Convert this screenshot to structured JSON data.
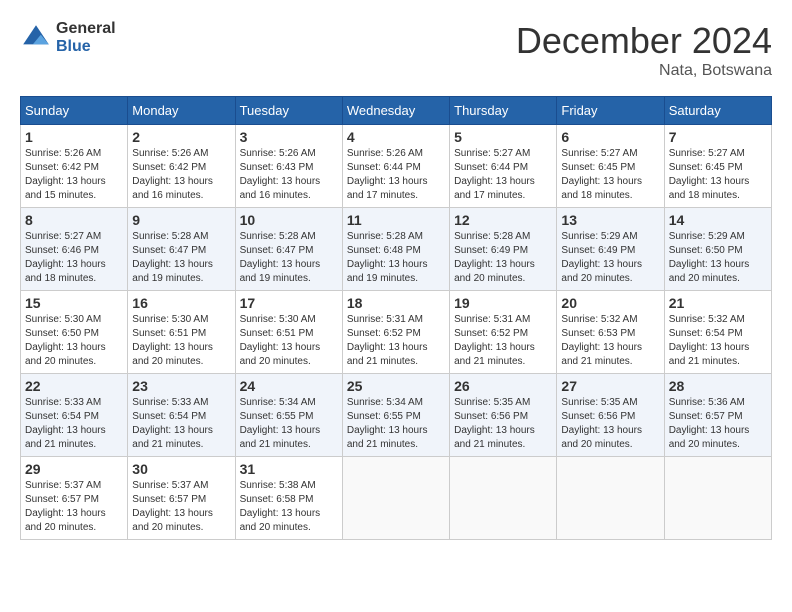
{
  "header": {
    "logo_general": "General",
    "logo_blue": "Blue",
    "month_title": "December 2024",
    "location": "Nata, Botswana"
  },
  "weekdays": [
    "Sunday",
    "Monday",
    "Tuesday",
    "Wednesday",
    "Thursday",
    "Friday",
    "Saturday"
  ],
  "weeks": [
    [
      {
        "day": 1,
        "sunrise": "5:26 AM",
        "sunset": "6:42 PM",
        "daylight": "13 hours and 15 minutes."
      },
      {
        "day": 2,
        "sunrise": "5:26 AM",
        "sunset": "6:42 PM",
        "daylight": "13 hours and 16 minutes."
      },
      {
        "day": 3,
        "sunrise": "5:26 AM",
        "sunset": "6:43 PM",
        "daylight": "13 hours and 16 minutes."
      },
      {
        "day": 4,
        "sunrise": "5:26 AM",
        "sunset": "6:44 PM",
        "daylight": "13 hours and 17 minutes."
      },
      {
        "day": 5,
        "sunrise": "5:27 AM",
        "sunset": "6:44 PM",
        "daylight": "13 hours and 17 minutes."
      },
      {
        "day": 6,
        "sunrise": "5:27 AM",
        "sunset": "6:45 PM",
        "daylight": "13 hours and 18 minutes."
      },
      {
        "day": 7,
        "sunrise": "5:27 AM",
        "sunset": "6:45 PM",
        "daylight": "13 hours and 18 minutes."
      }
    ],
    [
      {
        "day": 8,
        "sunrise": "5:27 AM",
        "sunset": "6:46 PM",
        "daylight": "13 hours and 18 minutes."
      },
      {
        "day": 9,
        "sunrise": "5:28 AM",
        "sunset": "6:47 PM",
        "daylight": "13 hours and 19 minutes."
      },
      {
        "day": 10,
        "sunrise": "5:28 AM",
        "sunset": "6:47 PM",
        "daylight": "13 hours and 19 minutes."
      },
      {
        "day": 11,
        "sunrise": "5:28 AM",
        "sunset": "6:48 PM",
        "daylight": "13 hours and 19 minutes."
      },
      {
        "day": 12,
        "sunrise": "5:28 AM",
        "sunset": "6:49 PM",
        "daylight": "13 hours and 20 minutes."
      },
      {
        "day": 13,
        "sunrise": "5:29 AM",
        "sunset": "6:49 PM",
        "daylight": "13 hours and 20 minutes."
      },
      {
        "day": 14,
        "sunrise": "5:29 AM",
        "sunset": "6:50 PM",
        "daylight": "13 hours and 20 minutes."
      }
    ],
    [
      {
        "day": 15,
        "sunrise": "5:30 AM",
        "sunset": "6:50 PM",
        "daylight": "13 hours and 20 minutes."
      },
      {
        "day": 16,
        "sunrise": "5:30 AM",
        "sunset": "6:51 PM",
        "daylight": "13 hours and 20 minutes."
      },
      {
        "day": 17,
        "sunrise": "5:30 AM",
        "sunset": "6:51 PM",
        "daylight": "13 hours and 20 minutes."
      },
      {
        "day": 18,
        "sunrise": "5:31 AM",
        "sunset": "6:52 PM",
        "daylight": "13 hours and 21 minutes."
      },
      {
        "day": 19,
        "sunrise": "5:31 AM",
        "sunset": "6:52 PM",
        "daylight": "13 hours and 21 minutes."
      },
      {
        "day": 20,
        "sunrise": "5:32 AM",
        "sunset": "6:53 PM",
        "daylight": "13 hours and 21 minutes."
      },
      {
        "day": 21,
        "sunrise": "5:32 AM",
        "sunset": "6:54 PM",
        "daylight": "13 hours and 21 minutes."
      }
    ],
    [
      {
        "day": 22,
        "sunrise": "5:33 AM",
        "sunset": "6:54 PM",
        "daylight": "13 hours and 21 minutes."
      },
      {
        "day": 23,
        "sunrise": "5:33 AM",
        "sunset": "6:54 PM",
        "daylight": "13 hours and 21 minutes."
      },
      {
        "day": 24,
        "sunrise": "5:34 AM",
        "sunset": "6:55 PM",
        "daylight": "13 hours and 21 minutes."
      },
      {
        "day": 25,
        "sunrise": "5:34 AM",
        "sunset": "6:55 PM",
        "daylight": "13 hours and 21 minutes."
      },
      {
        "day": 26,
        "sunrise": "5:35 AM",
        "sunset": "6:56 PM",
        "daylight": "13 hours and 21 minutes."
      },
      {
        "day": 27,
        "sunrise": "5:35 AM",
        "sunset": "6:56 PM",
        "daylight": "13 hours and 20 minutes."
      },
      {
        "day": 28,
        "sunrise": "5:36 AM",
        "sunset": "6:57 PM",
        "daylight": "13 hours and 20 minutes."
      }
    ],
    [
      {
        "day": 29,
        "sunrise": "5:37 AM",
        "sunset": "6:57 PM",
        "daylight": "13 hours and 20 minutes."
      },
      {
        "day": 30,
        "sunrise": "5:37 AM",
        "sunset": "6:57 PM",
        "daylight": "13 hours and 20 minutes."
      },
      {
        "day": 31,
        "sunrise": "5:38 AM",
        "sunset": "6:58 PM",
        "daylight": "13 hours and 20 minutes."
      },
      null,
      null,
      null,
      null
    ]
  ]
}
